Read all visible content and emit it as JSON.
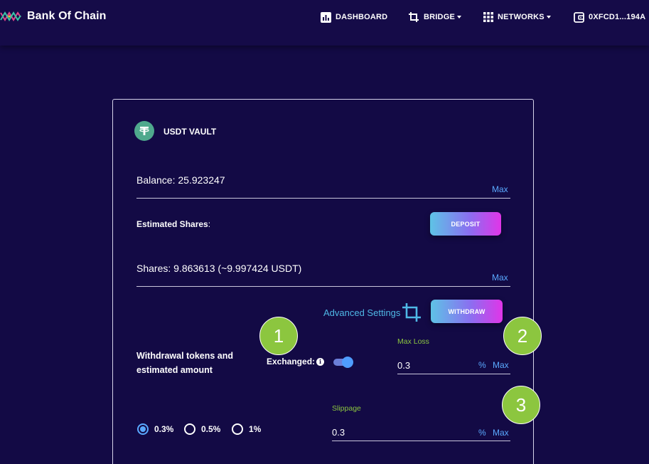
{
  "header": {
    "brand_name": "Bank Of Chain",
    "nav": {
      "dashboard": "DASHBOARD",
      "bridge": "BRIDGE",
      "networks": "NETWORKS",
      "wallet": "0XFCD1...194A"
    }
  },
  "vault": {
    "title": "USDT VAULT",
    "balance_text": "Balance: 25.923247",
    "balance_max": "Max",
    "estimated_shares_label": "Estimated Shares",
    "estimated_shares_suffix": ":",
    "deposit_button": "DEPOSIT",
    "shares_text": "Shares: 9.863613 (~9.997424 USDT)",
    "shares_max": "Max",
    "advanced_settings": "Advanced Settings",
    "withdraw_button": "WITHDRAW",
    "withdrawal_label_line1": "Withdrawal tokens and",
    "withdrawal_label_line2": "estimated amount",
    "exchanged_label": "Exchanged:",
    "exchanged_enabled": true,
    "max_loss_label": "Max Loss",
    "max_loss_value": "0.3",
    "max_loss_unit": "%",
    "max_loss_max": "Max",
    "slippage_label": "Slippage",
    "slippage_value": "0.3",
    "slippage_unit": "%",
    "slippage_max": "Max",
    "slippage_options": [
      "0.3%",
      "0.5%",
      "1%"
    ],
    "slippage_selected": "0.3%"
  },
  "annotations": [
    "1",
    "2",
    "3"
  ],
  "colors": {
    "background": "#130a45",
    "accent_link": "#5aa9ff",
    "annotation_green": "#8cc63f",
    "token_teal": "#4fa98d"
  }
}
